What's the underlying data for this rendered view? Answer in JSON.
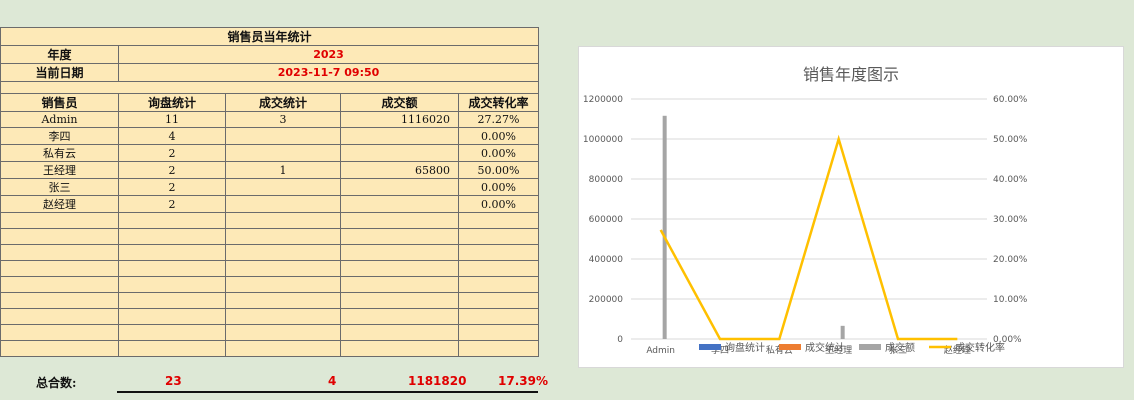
{
  "sheet": {
    "title": "销售员当年统计",
    "year_label": "年度",
    "year_value": "2023",
    "date_label": "当前日期",
    "date_value": "2023-11-7 09:50",
    "headers": [
      "销售员",
      "询盘统计",
      "成交统计",
      "成交额",
      "成交转化率"
    ],
    "rows": [
      [
        "Admin",
        "11",
        "3",
        "1116020",
        "27.27%"
      ],
      [
        "李四",
        "4",
        "",
        "",
        "0.00%"
      ],
      [
        "私有云",
        "2",
        "",
        "",
        "0.00%"
      ],
      [
        "王经理",
        "2",
        "1",
        "65800",
        "50.00%"
      ],
      [
        "张三",
        "2",
        "",
        "",
        "0.00%"
      ],
      [
        "赵经理",
        "2",
        "",
        "",
        "0.00%"
      ]
    ],
    "totals": {
      "label": "总合数:",
      "inquiries": "23",
      "deals": "4",
      "amount": "1181820",
      "rate": "17.39%"
    }
  },
  "chart_data": {
    "type": "bar",
    "title": "销售年度图示",
    "categories": [
      "Admin",
      "李四",
      "私有云",
      "王经理",
      "张三",
      "赵经理"
    ],
    "y_left_ticks": [
      "0",
      "200000",
      "400000",
      "600000",
      "800000",
      "1000000",
      "1200000"
    ],
    "y_left_lim": [
      0,
      1200000
    ],
    "y_right_ticks": [
      "0.00%",
      "10.00%",
      "20.00%",
      "30.00%",
      "40.00%",
      "50.00%",
      "60.00%"
    ],
    "y_right_lim": [
      0,
      60
    ],
    "series": [
      {
        "name": "询盘统计",
        "kind": "bar",
        "axis": "left",
        "color": "#4472c4",
        "values": [
          11,
          4,
          2,
          2,
          2,
          2
        ]
      },
      {
        "name": "成交统计",
        "kind": "bar",
        "axis": "left",
        "color": "#ed7d31",
        "values": [
          3,
          0,
          0,
          1,
          0,
          0
        ]
      },
      {
        "name": "成交额",
        "kind": "bar",
        "axis": "left",
        "color": "#a5a5a5",
        "values": [
          1116020,
          0,
          0,
          65800,
          0,
          0
        ]
      },
      {
        "name": "成交转化率",
        "kind": "line",
        "axis": "right",
        "color": "#ffc000",
        "values": [
          27.27,
          0,
          0,
          50,
          0,
          0
        ]
      }
    ],
    "grid": true,
    "legend_position": "bottom"
  }
}
